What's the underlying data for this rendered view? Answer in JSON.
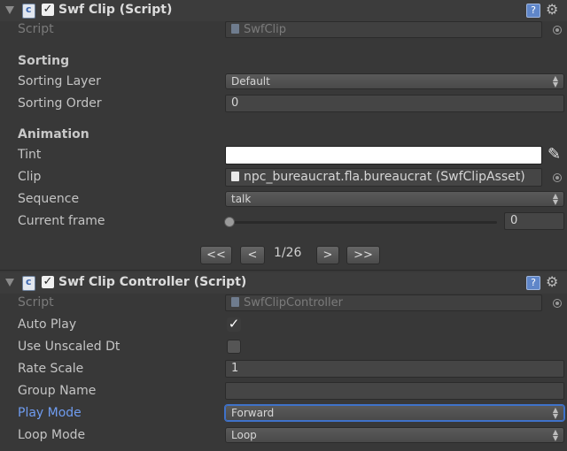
{
  "swf_clip": {
    "title": "Swf Clip (Script)",
    "enabled_mark": "✓",
    "script_label": "Script",
    "script_value": "SwfClip",
    "sorting_header": "Sorting",
    "sorting_layer_label": "Sorting Layer",
    "sorting_layer_value": "Default",
    "sorting_order_label": "Sorting Order",
    "sorting_order_value": "0",
    "animation_header": "Animation",
    "tint_label": "Tint",
    "tint_color": "#ffffff",
    "clip_label": "Clip",
    "clip_value": "npc_bureaucrat.fla.bureaucrat (SwfClipAsset)",
    "sequence_label": "Sequence",
    "sequence_value": "talk",
    "current_frame_label": "Current frame",
    "current_frame_value": "0",
    "nav": {
      "first": "<<",
      "prev": "<",
      "page": "1/26",
      "next": ">",
      "last": ">>"
    }
  },
  "swf_clip_controller": {
    "title": "Swf Clip Controller (Script)",
    "enabled_mark": "✓",
    "script_label": "Script",
    "script_value": "SwfClipController",
    "auto_play_label": "Auto Play",
    "auto_play_checked": true,
    "use_unscaled_dt_label": "Use Unscaled Dt",
    "use_unscaled_dt_checked": false,
    "rate_scale_label": "Rate Scale",
    "rate_scale_value": "1",
    "group_name_label": "Group Name",
    "group_name_value": "",
    "play_mode_label": "Play Mode",
    "play_mode_value": "Forward",
    "loop_mode_label": "Loop Mode",
    "loop_mode_value": "Loop"
  },
  "icons": {
    "help": "?",
    "gear": "⚙",
    "dropper": "✎",
    "popup_arrows": "▲▼"
  },
  "colors": {
    "background": "#383838",
    "accent_blue": "#6f9cf0",
    "focus_border": "#3f72c9"
  }
}
